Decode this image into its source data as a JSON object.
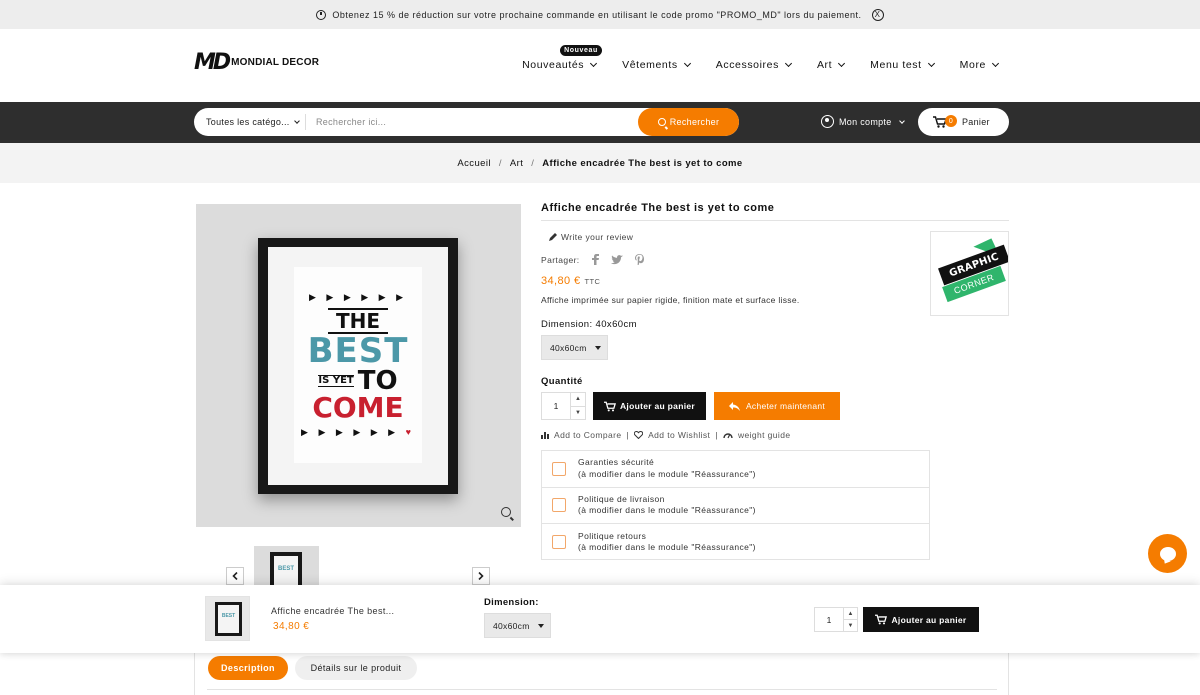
{
  "promo": {
    "text": "Obtenez 15 % de réduction sur votre prochaine commande en utilisant le code promo \"PROMO_MD\" lors du paiement.",
    "close": "X"
  },
  "header": {
    "logo_mark": "MD",
    "logo_name": "MONDIAL DECOR",
    "nav": [
      {
        "label": "Nouveautés",
        "badge": "Nouveau"
      },
      {
        "label": "Vêtements"
      },
      {
        "label": "Accessoires"
      },
      {
        "label": "Art"
      },
      {
        "label": "Menu test"
      },
      {
        "label": "More"
      }
    ]
  },
  "search": {
    "category": "Toutes les catégo...",
    "placeholder": "Rechercher ici...",
    "button": "Rechercher",
    "account": "Mon compte",
    "cart_label": "Panier",
    "cart_count": "0"
  },
  "breadcrumb": [
    "Accueil",
    "Art",
    "Affiche encadrée The best is yet to come"
  ],
  "breadcrumb_sep": "/",
  "product": {
    "title": "Affiche encadrée The best is yet to come",
    "review": "Write your review",
    "share_label": "Partager:",
    "share_icons": [
      "facebook-icon",
      "twitter-icon",
      "pinterest-icon"
    ],
    "price": "34,80 €",
    "tax": "TTC",
    "description": "Affiche imprimée sur papier rigide, finition mate et surface lisse.",
    "dimension_label": "Dimension: 40x60cm",
    "dimension_value": "40x60cm",
    "quantity_label": "Quantité",
    "quantity": "1",
    "add_to_cart": "Ajouter au panier",
    "buy_now": "Acheter maintenant",
    "links": [
      "Add to Compare",
      "Add to Wishlist",
      "weight guide"
    ],
    "link_sep": "|",
    "brand_top": "GRAPHIC",
    "brand_bottom": "CORNER",
    "poster": {
      "arrows": "▶ ▶ ▶ ▶ ▶ ▶",
      "arrows_bottom": "▶ ▶ ▶ ▶ ▶ ▶",
      "heart": "♥",
      "the": "THE",
      "best": "BEST",
      "is_yet": "IS YET",
      "to": "TO",
      "come": "COME"
    },
    "thumb_text": "BEST"
  },
  "reassurance": [
    {
      "title": "Garanties sécurité",
      "sub": "(à modifier dans le module \"Réassurance\")"
    },
    {
      "title": "Politique de livraison",
      "sub": "(à modifier dans le module \"Réassurance\")"
    },
    {
      "title": "Politique retours",
      "sub": "(à modifier dans le module \"Réassurance\")"
    }
  ],
  "sticky": {
    "name": "Affiche encadrée The best...",
    "price": "34,80 €",
    "dimension_label": "Dimension:",
    "dimension_value": "40x60cm",
    "quantity": "1",
    "add_to_cart": "Ajouter au panier"
  },
  "tabs": [
    "Description",
    "Détails sur le produit"
  ],
  "colors": {
    "accent": "#f57c00",
    "dark": "#2e2e2e",
    "poster_blue": "#4c98a8",
    "poster_red": "#c8202f",
    "brand_green": "#2fb56c"
  }
}
